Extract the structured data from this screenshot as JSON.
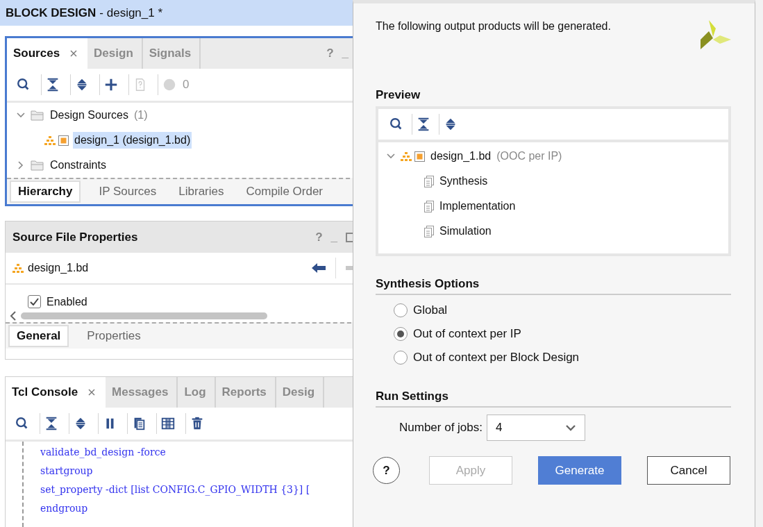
{
  "title_bar": {
    "title": "BLOCK DESIGN",
    "subtitle": "- design_1 *"
  },
  "sources_panel": {
    "tabs": [
      {
        "label": "Sources",
        "selected": true,
        "closable": true
      },
      {
        "label": "Design",
        "selected": false,
        "closable": false
      },
      {
        "label": "Signals",
        "selected": false,
        "closable": false
      }
    ],
    "panel_buttons": [
      "?",
      "_"
    ],
    "tools": [
      {
        "kind": "search"
      },
      {
        "kind": "collapse"
      },
      {
        "kind": "expand"
      },
      {
        "kind": "add"
      },
      {
        "kind": "unknown-file",
        "disabled": true
      },
      {
        "kind": "status",
        "disabled": true
      }
    ],
    "status_count": "0",
    "tree": [
      {
        "kind": "folder",
        "label": "Design Sources",
        "count": "(1)",
        "expanded": true,
        "children": [
          {
            "kind": "design",
            "label": "design_1 (design_1.bd)",
            "selected": true
          }
        ]
      },
      {
        "kind": "folder",
        "label": "Constraints",
        "expanded": false
      }
    ],
    "bottom_tabs": [
      {
        "label": "Hierarchy",
        "selected": true
      },
      {
        "label": "IP Sources",
        "selected": false
      },
      {
        "label": "Libraries",
        "selected": false
      },
      {
        "label": "Compile Order",
        "selected": false
      }
    ]
  },
  "properties_panel": {
    "title": "Source File Properties",
    "panel_buttons": [
      "?",
      "_"
    ],
    "file": "design_1.bd",
    "checkbox": {
      "label": "Enabled",
      "checked": true
    },
    "bottom_tabs": [
      {
        "label": "General",
        "selected": true
      },
      {
        "label": "Properties",
        "selected": false
      }
    ]
  },
  "console_panel": {
    "tabs": [
      {
        "label": "Tcl Console",
        "selected": true,
        "closable": true
      },
      {
        "label": "Messages",
        "selected": false,
        "closable": false
      },
      {
        "label": "Log",
        "selected": false,
        "closable": false
      },
      {
        "label": "Reports",
        "selected": false,
        "closable": false
      },
      {
        "label": "Desig",
        "selected": false,
        "closable": false
      }
    ],
    "tools": [
      {
        "kind": "search"
      },
      {
        "kind": "collapse"
      },
      {
        "kind": "expand"
      },
      {
        "kind": "pause"
      },
      {
        "kind": "copy"
      },
      {
        "kind": "columns"
      },
      {
        "kind": "delete"
      }
    ],
    "lines": [
      "validate_bd_design -force",
      "startgroup",
      "set_property -dict [list CONFIG.C_GPIO_WIDTH {3}] [",
      "endgroup"
    ]
  },
  "dialog": {
    "message": "The following output products will be generated.",
    "preview": {
      "title": "Preview",
      "tools": [
        {
          "kind": "search"
        },
        {
          "kind": "collapse"
        },
        {
          "kind": "expand"
        }
      ],
      "tree": [
        {
          "kind": "design",
          "label": "design_1.bd",
          "note": "(OOC per IP)",
          "expanded": true,
          "children": [
            {
              "kind": "file",
              "label": "Synthesis"
            },
            {
              "kind": "file",
              "label": "Implementation"
            },
            {
              "kind": "file",
              "label": "Simulation"
            }
          ]
        }
      ]
    },
    "synthesis_options": {
      "title": "Synthesis Options",
      "options": [
        {
          "label": "Global",
          "selected": false
        },
        {
          "label": "Out of context per IP",
          "selected": true
        },
        {
          "label": "Out of context per Block Design",
          "selected": false
        }
      ]
    },
    "run_settings": {
      "title": "Run Settings",
      "jobs_label": "Number of jobs:",
      "jobs_value": "4"
    },
    "buttons": [
      {
        "kind": "help",
        "label": "?",
        "disabled": false
      },
      {
        "kind": "normal",
        "label": "Apply",
        "disabled": true
      },
      {
        "kind": "primary",
        "label": "Generate",
        "disabled": false
      },
      {
        "kind": "normal",
        "label": "Cancel",
        "disabled": false
      }
    ]
  }
}
